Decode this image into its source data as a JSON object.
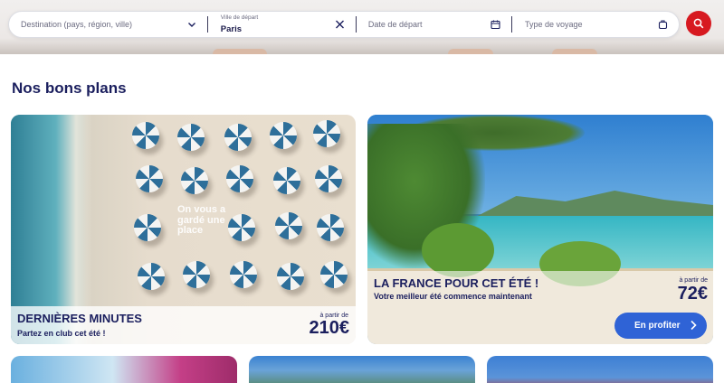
{
  "search": {
    "destination_placeholder": "Destination (pays, région, ville)",
    "departure_label": "Ville de départ",
    "departure_value": "Paris",
    "date_placeholder": "Date de départ",
    "trip_type_placeholder": "Type de voyage"
  },
  "section": {
    "title": "Nos bons plans"
  },
  "deals": [
    {
      "title": "DERNIÈRES MINUTES",
      "subtitle": "Partez en club cet été !",
      "from_label": "à partir de",
      "price": "210€",
      "overlay": "On vous a gardé une place"
    },
    {
      "title": "LA FRANCE POUR CET ÉTÉ !",
      "subtitle": "Votre meilleur été commence maintenant",
      "from_label": "à partir de",
      "price": "72€",
      "cta": "En profiter"
    }
  ],
  "colors": {
    "brand_navy": "#1b1f5e",
    "search_red": "#d71920",
    "cta_blue": "#2f63d6"
  },
  "icons": [
    "chevron-down-icon",
    "close-icon",
    "calendar-icon",
    "suitcase-icon",
    "search-icon",
    "chevron-right-icon"
  ]
}
